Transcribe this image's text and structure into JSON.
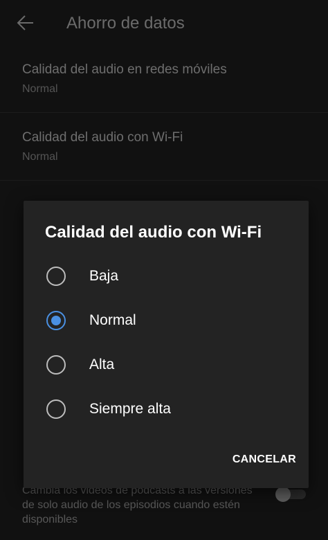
{
  "appbar": {
    "title": "Ahorro de datos"
  },
  "settings": [
    {
      "title": "Calidad del audio en redes móviles",
      "value": "Normal"
    },
    {
      "title": "Calidad del audio con Wi-Fi",
      "value": "Normal"
    }
  ],
  "background_bottom": {
    "description": "Cambia los videos de podcasts a las versiones de solo audio de los episodios cuando estén disponibles",
    "toggle_on": false
  },
  "dialog": {
    "title": "Calidad del audio con Wi-Fi",
    "options": [
      {
        "label": "Baja",
        "selected": false
      },
      {
        "label": "Normal",
        "selected": true
      },
      {
        "label": "Alta",
        "selected": false
      },
      {
        "label": "Siempre alta",
        "selected": false
      }
    ],
    "cancel_label": "CANCELAR"
  },
  "colors": {
    "accent": "#4a90e2",
    "dialog_bg": "#232323",
    "page_bg": "#111111"
  },
  "icons": {
    "back": "arrow-left-icon"
  }
}
